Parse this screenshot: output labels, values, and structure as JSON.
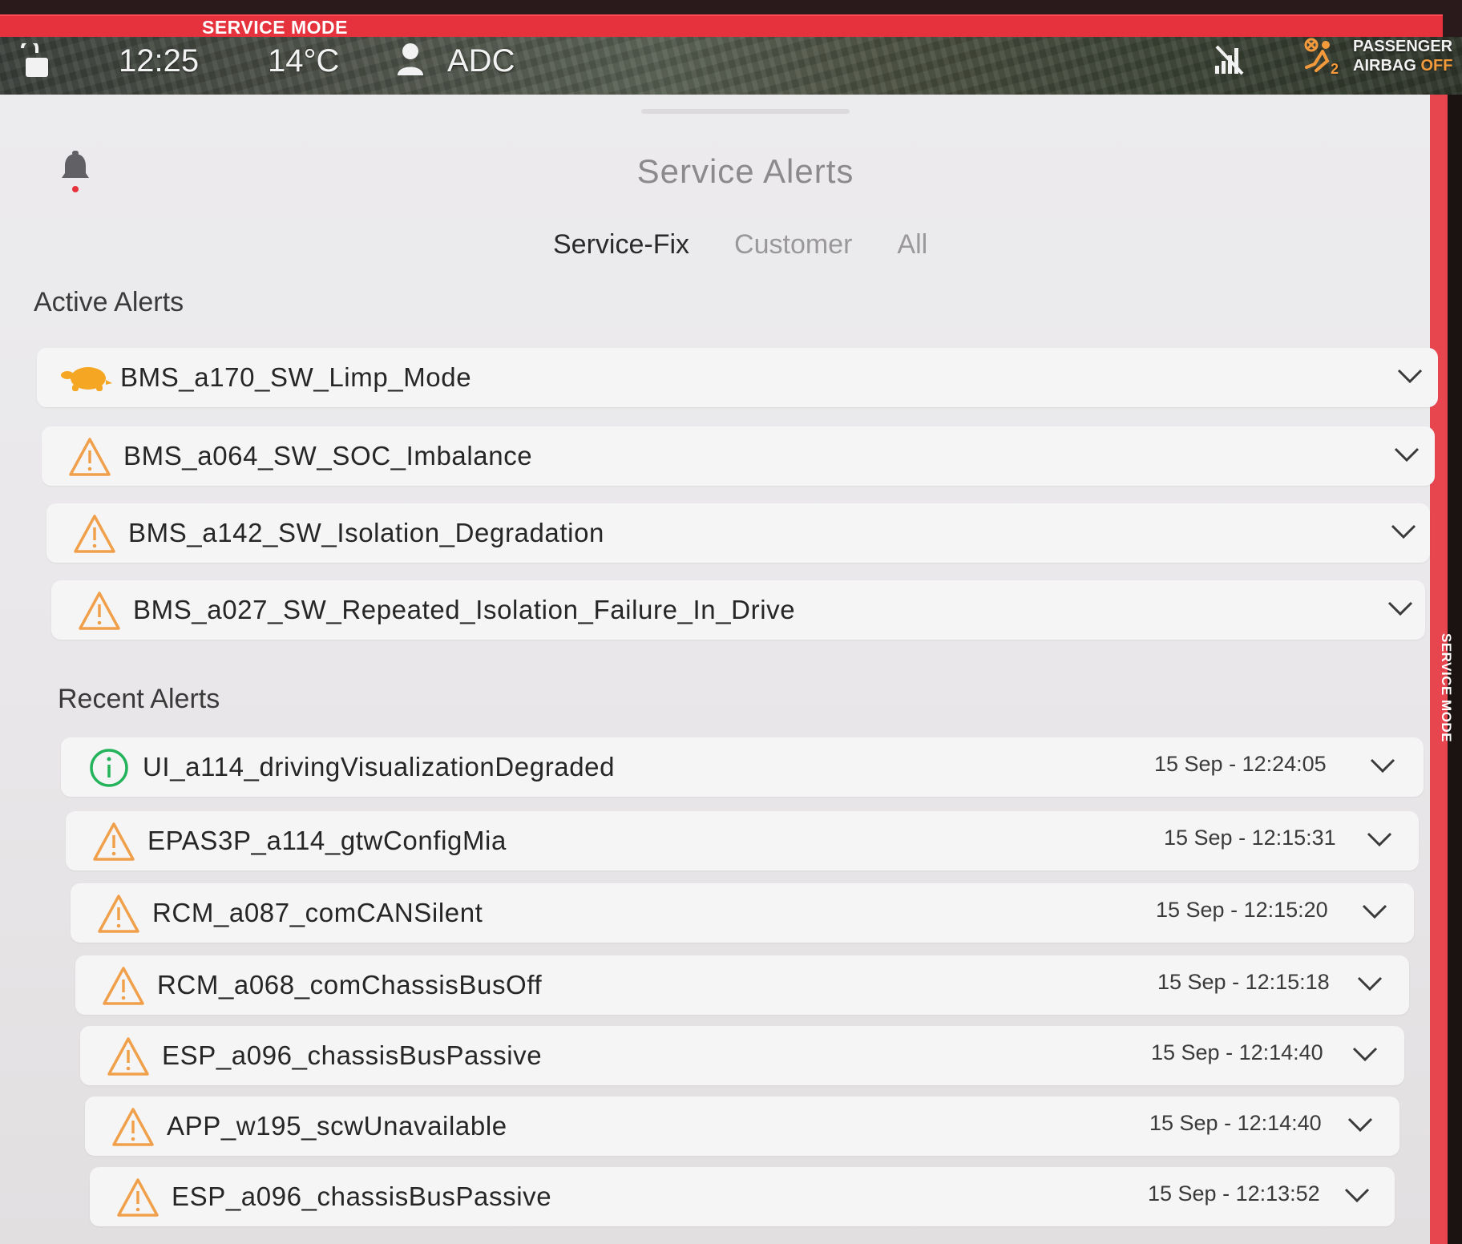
{
  "status_bar": {
    "service_mode_banner": "SERVICE MODE",
    "time": "12:25",
    "temperature": "14°C",
    "profile_name": "ADC",
    "airbag_line1": "PASSENGER",
    "airbag_line2_prefix": "AIRBAG ",
    "airbag_line2_status": "OFF",
    "airbag_count": "2"
  },
  "side_strip": {
    "label": "SERVICE MODE"
  },
  "panel": {
    "title": "Service Alerts",
    "tabs": [
      {
        "label": "Service-Fix",
        "active": true
      },
      {
        "label": "Customer",
        "active": false
      },
      {
        "label": "All",
        "active": false
      }
    ]
  },
  "active_alerts": {
    "title": "Active Alerts",
    "items": [
      {
        "icon": "turtle-icon",
        "label": "BMS_a170_SW_Limp_Mode"
      },
      {
        "icon": "warning-icon",
        "label": "BMS_a064_SW_SOC_Imbalance"
      },
      {
        "icon": "warning-icon",
        "label": "BMS_a142_SW_Isolation_Degradation"
      },
      {
        "icon": "warning-icon",
        "label": "BMS_a027_SW_Repeated_Isolation_Failure_In_Drive"
      }
    ]
  },
  "recent_alerts": {
    "title": "Recent Alerts",
    "items": [
      {
        "icon": "info-icon",
        "label": "UI_a114_drivingVisualizationDegraded",
        "timestamp": "15 Sep - 12:24:05"
      },
      {
        "icon": "warning-icon",
        "label": "EPAS3P_a114_gtwConfigMia",
        "timestamp": "15 Sep - 12:15:31"
      },
      {
        "icon": "warning-icon",
        "label": "RCM_a087_comCANSilent",
        "timestamp": "15 Sep - 12:15:20"
      },
      {
        "icon": "warning-icon",
        "label": "RCM_a068_comChassisBusOff",
        "timestamp": "15 Sep - 12:15:18"
      },
      {
        "icon": "warning-icon",
        "label": "ESP_a096_chassisBusPassive",
        "timestamp": "15 Sep - 12:14:40"
      },
      {
        "icon": "warning-icon",
        "label": "APP_w195_scwUnavailable",
        "timestamp": "15 Sep - 12:14:40"
      },
      {
        "icon": "warning-icon",
        "label": "ESP_a096_chassisBusPassive",
        "timestamp": "15 Sep - 12:13:52"
      }
    ]
  },
  "colors": {
    "service_red": "#e5323d",
    "warning_orange": "#f0a04a",
    "info_green": "#22b35b",
    "turtle_orange": "#f5a623"
  }
}
